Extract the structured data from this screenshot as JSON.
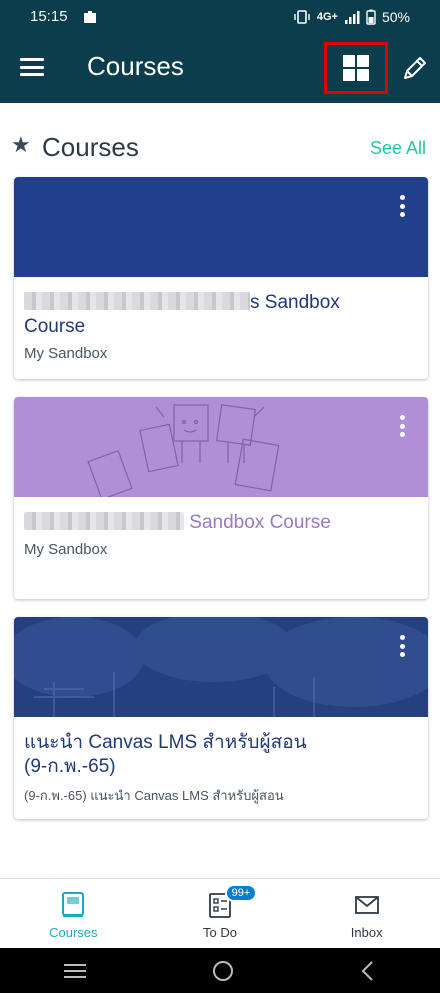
{
  "status_bar": {
    "time": "15:15",
    "network": "4G+",
    "battery": "50%"
  },
  "app_bar": {
    "title": "Courses"
  },
  "section": {
    "title": "Courses",
    "see_all": "See All"
  },
  "courses": [
    {
      "name_suffix": "s Sandbox",
      "name_line2": "Course",
      "term": "My Sandbox",
      "color": "#213f8b",
      "text_color": "#1e3a78"
    },
    {
      "name_suffix": " Sandbox Course",
      "term": "My Sandbox",
      "color": "#b08fd6",
      "text_color": "#9a79c4"
    },
    {
      "name_line1": "แนะนำ Canvas LMS สำหรับผู้สอน",
      "name_line2": "(9-ก.พ.-65)",
      "term": "(9-ก.พ.-65) แนะนำ Canvas LMS สำหรับผู้สอน",
      "color": "#24407e",
      "text_color": "#1e3a78"
    }
  ],
  "bottom_nav": {
    "courses": "Courses",
    "todo": "To Do",
    "todo_badge": "99+",
    "inbox": "Inbox"
  },
  "colors": {
    "app_bar": "#0c3d4d",
    "accent": "#1fc7a8",
    "active_tab": "#1ba9c0"
  }
}
